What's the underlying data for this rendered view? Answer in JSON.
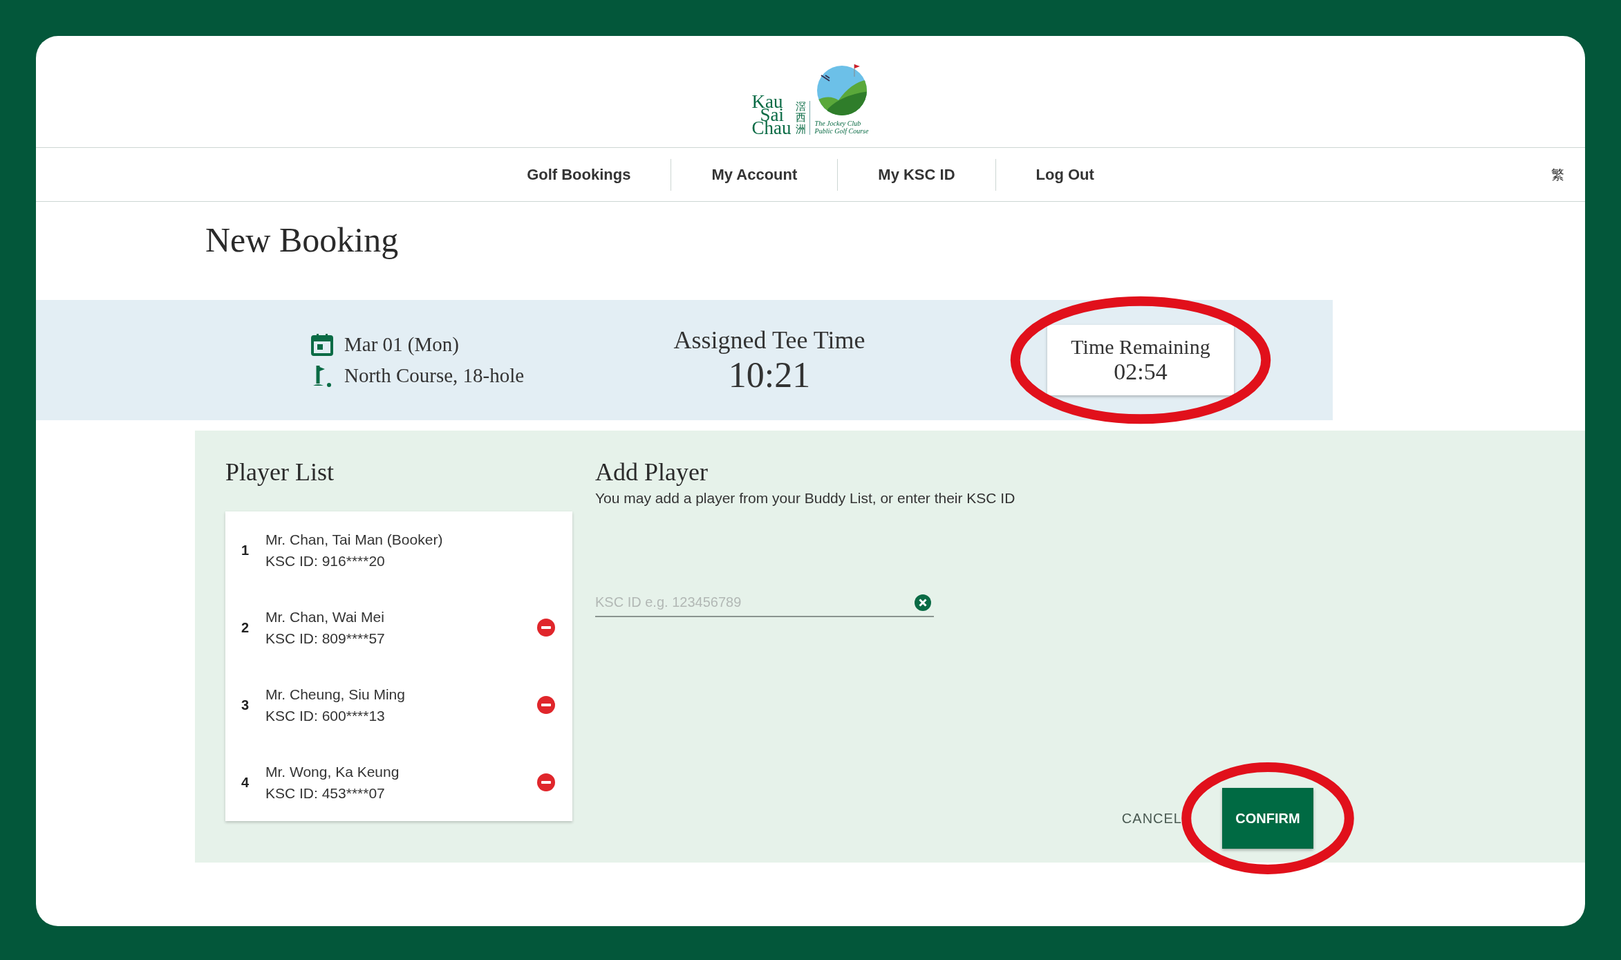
{
  "logo": {
    "wordmark": [
      "Kau",
      "Sai",
      "Chau"
    ],
    "chinese_name": "滘西洲",
    "tagline": [
      "The Jockey Club",
      "Public Golf Course"
    ]
  },
  "nav": {
    "items": [
      "Golf Bookings",
      "My Account",
      "My KSC ID",
      "Log Out"
    ],
    "language_toggle": "繁"
  },
  "page_title": "New Booking",
  "booking": {
    "date": "Mar 01 (Mon)",
    "course": "North Course, 18-hole",
    "tee_time_label": "Assigned Tee Time",
    "tee_time": "10:21",
    "countdown": {
      "label": "Time Remaining",
      "value": "02:54",
      "highlighted": true
    }
  },
  "player_list": {
    "title": "Player List",
    "players": [
      {
        "number": "1",
        "name": "Mr. Chan, Tai Man (Booker)",
        "ksc_id": "KSC ID: 916****20",
        "removable": false
      },
      {
        "number": "2",
        "name": "Mr. Chan, Wai Mei",
        "ksc_id": "KSC ID: 809****57",
        "removable": true
      },
      {
        "number": "3",
        "name": "Mr. Cheung, Siu Ming",
        "ksc_id": "KSC ID: 600****13",
        "removable": true
      },
      {
        "number": "4",
        "name": "Mr. Wong, Ka Keung",
        "ksc_id": "KSC ID: 453****07",
        "removable": true
      }
    ]
  },
  "add_player": {
    "title": "Add Player",
    "hint": "You may add a player from your Buddy List, or enter their KSC ID",
    "ksc_id_field": {
      "placeholder": "KSC ID e.g. 123456789"
    },
    "buttons": [
      {
        "label": "CANCEL",
        "kind": "text",
        "highlighted": false
      },
      {
        "label": "CONFIRM",
        "kind": "primary",
        "highlighted": true
      }
    ]
  }
}
